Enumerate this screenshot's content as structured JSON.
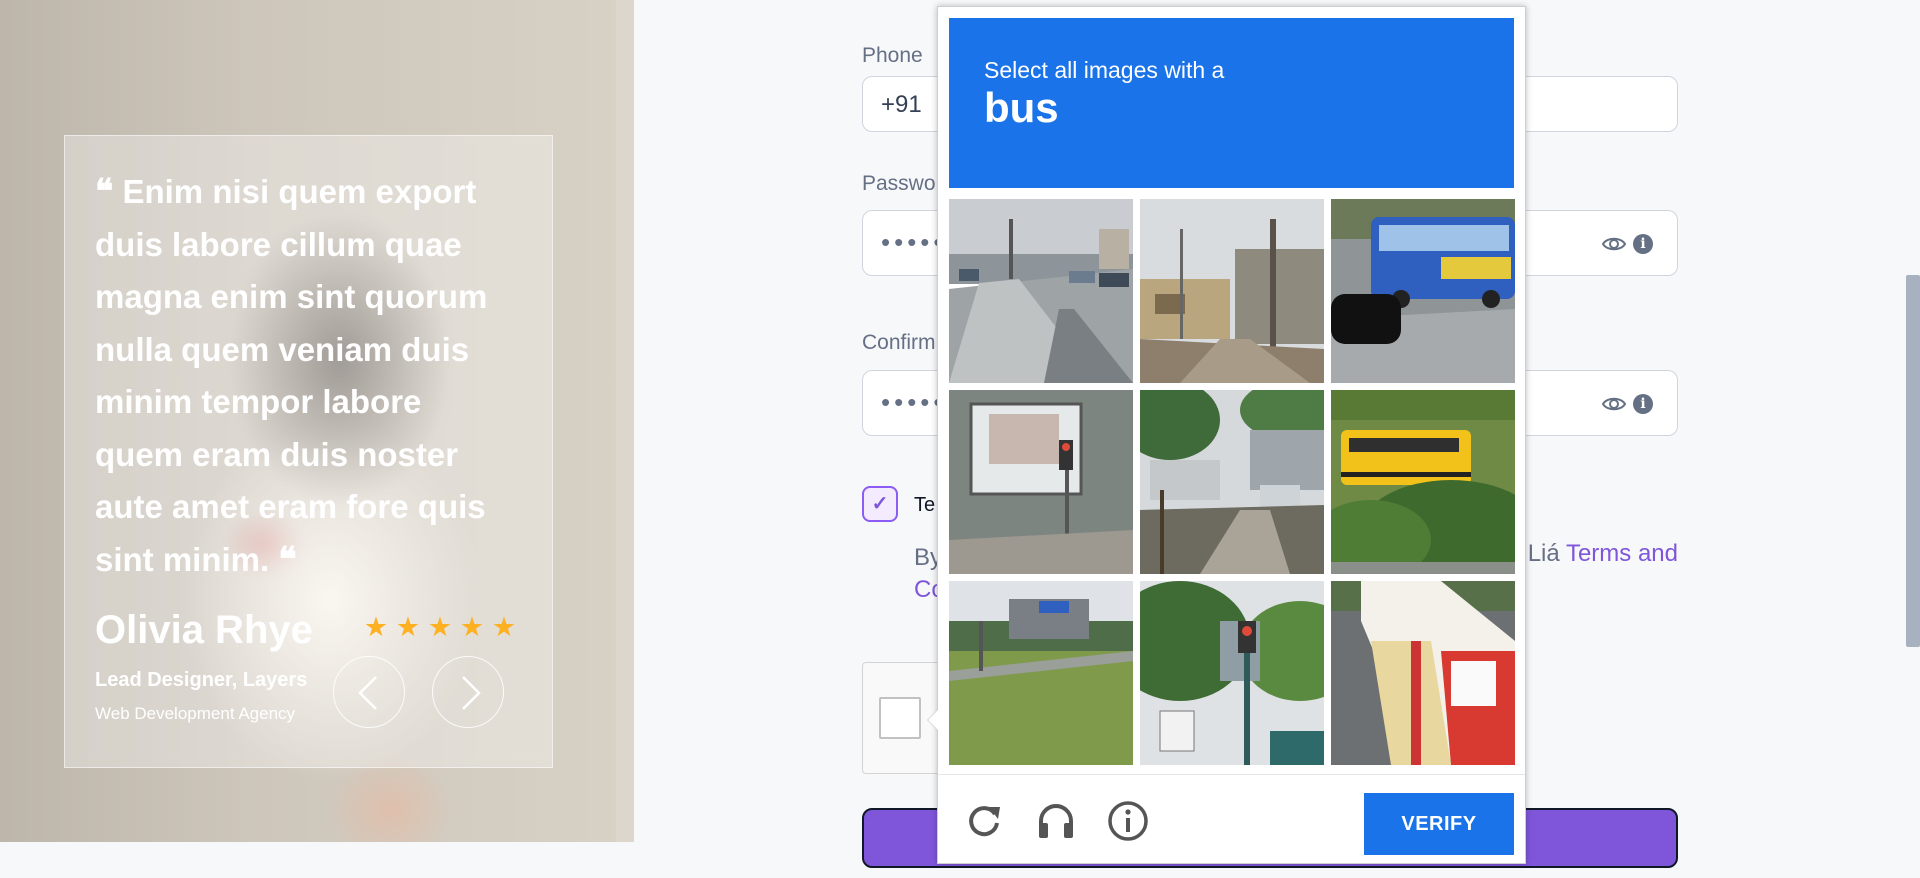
{
  "testimonial": {
    "quote": "Enim nisi quem export duis labore cillum quae magna enim sint quorum nulla quem veniam duis minim tempor labore quem eram duis noster aute amet eram fore quis sint minim.",
    "open_mark": "❝",
    "close_mark": "❝",
    "author": "Olivia Rhye",
    "role": "Lead Designer, Layers",
    "company": "Web Development Agency",
    "rating": 5,
    "star_glyph": "★"
  },
  "form": {
    "phone_label": "Phone",
    "phone_value": "+91",
    "password_label": "Passwo",
    "password_dots": "•••••",
    "confirm_label": "Confirm",
    "confirm_dots": "•••••",
    "info_glyph": "i",
    "terms_label": "Te",
    "terms_checkmark": "✓",
    "consent_start": "By",
    "consent_tail": "Liá",
    "consent_link": "Terms and",
    "consent_line2": "Co"
  },
  "captcha": {
    "instruction": "Select all images with a",
    "target": "bus",
    "verify_label": "VERIFY"
  },
  "colors": {
    "brand_purple": "#7f56d9",
    "captcha_blue": "#1a73e8",
    "star_yellow": "#fdb022"
  }
}
